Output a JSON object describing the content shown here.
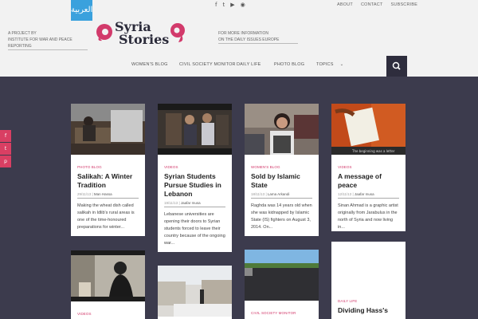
{
  "header": {
    "arabic_button": "العربية",
    "top_links": [
      "ABOUT",
      "CONTACT",
      "SUBSCRIBE"
    ],
    "social_icons": [
      "facebook-icon",
      "twitter-icon",
      "youtube-icon",
      "rss-icon"
    ],
    "project_left": [
      "A PROJECT BY",
      "INSTITUTE FOR WAR AND PEACE REPORTING"
    ],
    "project_right": [
      "FOR MORE INFORMATION",
      "ON THE DAILY ISSUES EUROPE"
    ],
    "logo_line1": "Syria",
    "logo_line2": "Stories",
    "nav": [
      "WOMEN'S BLOG",
      "CIVIL SOCIETY MONITOR",
      "DAILY LIFE",
      "PHOTO BLOG",
      "TOPICS"
    ]
  },
  "share": [
    "f",
    "t",
    "p"
  ],
  "cards": [
    {
      "tag": "PHOTO BLOG",
      "title": "Salikah: A Winter Tradition",
      "date": "29/11/13",
      "author": "Man Hassa",
      "excerpt": "Making the wheat dish called salikah in Idlib's rural areas is one of the time-honoured preparations for winter..."
    },
    {
      "tag": "VIDEOS",
      "title": "Syrian Students Pursue Studies in Lebanon",
      "date": "19/11/13",
      "author": "Jaafar musa",
      "excerpt": "Lebanese universities are opening their doors to Syrian students forced to leave their country because of the ongoing war..."
    },
    {
      "tag": "WOMEN'S BLOG",
      "title": "Sold by Islamic State",
      "date": "18/11/13",
      "author": "Lama Arkandi",
      "excerpt": "Raghda was 14 years old when she was kidnapped by Islamic State (IS) fighters on August 3, 2014. On..."
    },
    {
      "tag": "VIDEOS",
      "title": "A message of peace",
      "date": "12/11/13",
      "author": "Jaafar musa",
      "excerpt": "Sinan Ahmad is a graphic artist originally from Jarabulus in the north of Syria and now living in..."
    },
    {
      "tag": "VIDEOS",
      "title": "",
      "date": "",
      "author": "",
      "excerpt": ""
    },
    {
      "tag": "",
      "title": "",
      "date": "",
      "author": "",
      "excerpt": ""
    },
    {
      "tag": "CIVIL SOCIETY MONITOR",
      "title": "",
      "date": "",
      "author": "",
      "excerpt": ""
    },
    {
      "tag": "DAILY LIFE",
      "title": "Dividing Hass's",
      "date": "",
      "author": "",
      "excerpt": ""
    }
  ]
}
